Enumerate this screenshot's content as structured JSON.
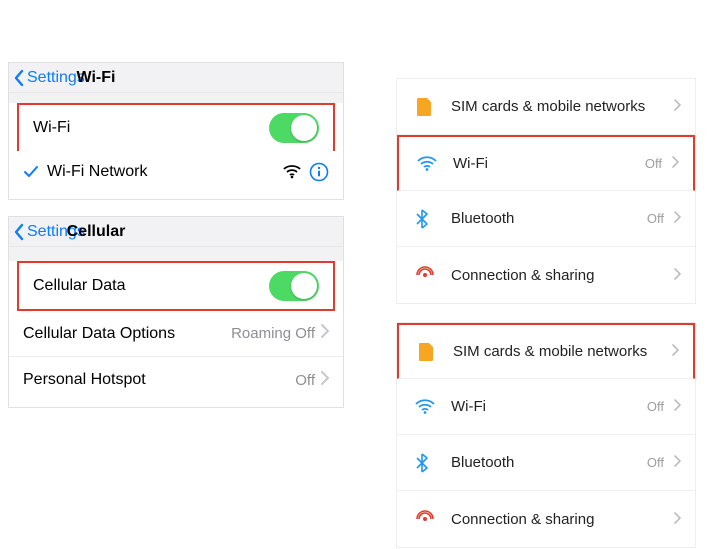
{
  "ios_wifi": {
    "back_label": "Settings",
    "title": "Wi-Fi",
    "toggle_label": "Wi-Fi",
    "network_name": "Wi-Fi Network"
  },
  "ios_cell": {
    "back_label": "Settings",
    "title": "Cellular",
    "toggle_label": "Cellular Data",
    "options_label": "Cellular Data Options",
    "options_value": "Roaming Off",
    "hotspot_label": "Personal Hotspot",
    "hotspot_value": "Off"
  },
  "android_a": {
    "rows": [
      {
        "label": "SIM cards & mobile networks",
        "value": ""
      },
      {
        "label": "Wi-Fi",
        "value": "Off"
      },
      {
        "label": "Bluetooth",
        "value": "Off"
      },
      {
        "label": "Connection & sharing",
        "value": ""
      }
    ]
  },
  "android_b": {
    "rows": [
      {
        "label": "SIM cards & mobile networks",
        "value": ""
      },
      {
        "label": "Wi-Fi",
        "value": "Off"
      },
      {
        "label": "Bluetooth",
        "value": "Off"
      },
      {
        "label": "Connection & sharing",
        "value": ""
      }
    ]
  },
  "colors": {
    "ios_blue": "#0a7cff",
    "toggle_green": "#4cd964",
    "highlight_red": "#e23b2e",
    "android_orange": "#f6a623",
    "android_blue": "#2196f3"
  }
}
